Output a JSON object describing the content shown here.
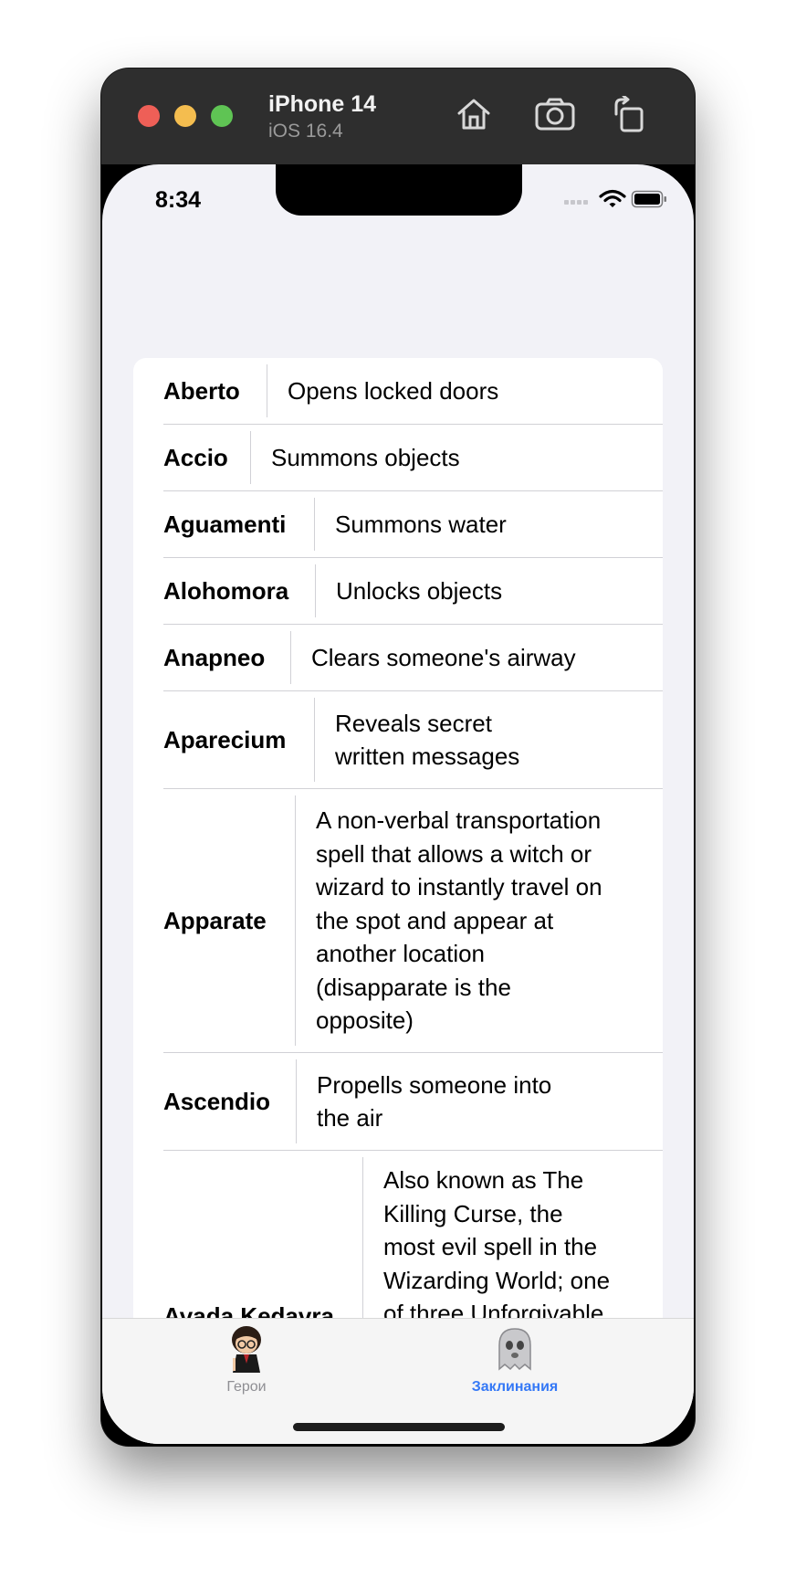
{
  "device": {
    "name": "iPhone 14",
    "os": "iOS 16.4"
  },
  "status_bar": {
    "time": "8:34"
  },
  "spells": [
    {
      "name": "Aberto",
      "desc": "Opens locked doors"
    },
    {
      "name": "Accio",
      "desc": "Summons objects"
    },
    {
      "name": "Aguamenti",
      "desc": "Summons water"
    },
    {
      "name": "Alohomora",
      "desc": "Unlocks objects"
    },
    {
      "name": "Anapneo",
      "desc": "Clears someone's airway"
    },
    {
      "name": "Aparecium",
      "desc": "Reveals secret\nwritten messages"
    },
    {
      "name": "Apparate",
      "desc": "A non-verbal transportation\nspell that allows a witch or\nwizard to instantly travel on\nthe spot and appear at\nanother location\n(disapparate is the\nopposite)"
    },
    {
      "name": "Ascendio",
      "desc": "Propells someone into\nthe air"
    },
    {
      "name": "Avada Kedavra",
      "desc": "Also known as The\nKilling Curse, the\nmost evil spell in the\nWizarding World; one\nof three Unforgivable\nCurses; Harry Potter\nis the only known"
    }
  ],
  "tabs": [
    {
      "label": "Герои",
      "icon": "harry-potter-avatar-icon",
      "selected": false
    },
    {
      "label": "Заклинания",
      "icon": "ghost-avatar-icon",
      "selected": true
    }
  ],
  "colors": {
    "accent": "#3478f6",
    "inactive_tab": "#8e8e93"
  }
}
